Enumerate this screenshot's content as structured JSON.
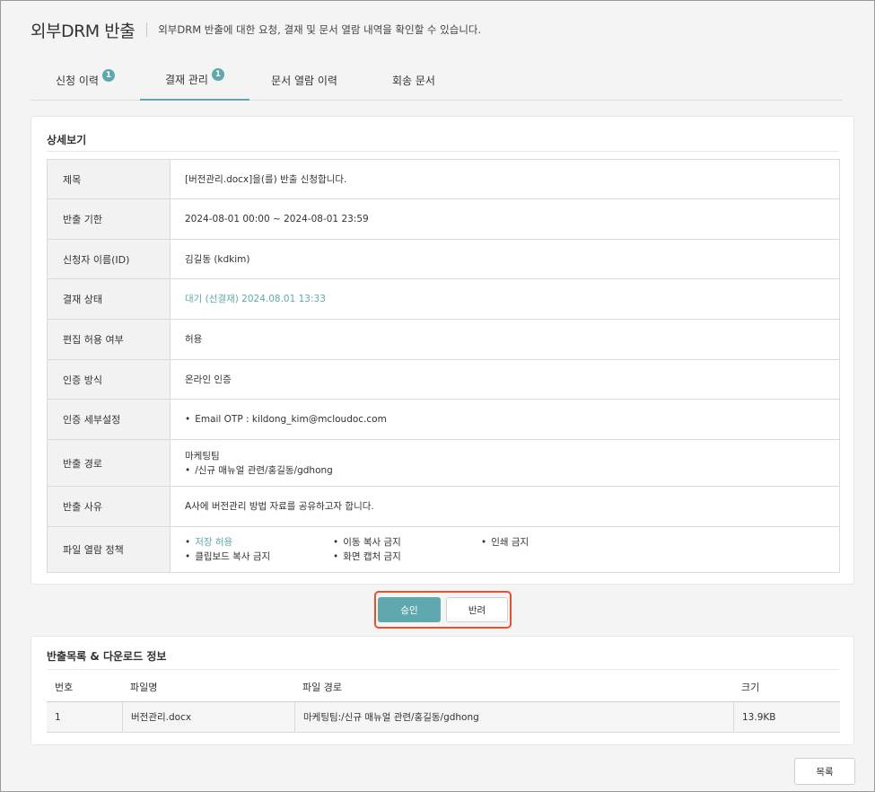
{
  "header": {
    "title": "외부DRM 반출",
    "description": "외부DRM 반출에 대한 요청, 결재 및 문서 열람 내역을 확인할 수 있습니다."
  },
  "tabs": [
    {
      "label": "신청 이력",
      "badge": "1"
    },
    {
      "label": "결재 관리",
      "badge": "1",
      "active": true
    },
    {
      "label": "문서 열람 이력"
    },
    {
      "label": "회송 문서"
    }
  ],
  "detail": {
    "title": "상세보기",
    "rows": {
      "subject": {
        "label": "제목",
        "value": "[버전관리.docx]을(를) 반출 신청합니다."
      },
      "period": {
        "label": "반출 기한",
        "value": "2024-08-01 00:00 ~ 2024-08-01 23:59"
      },
      "applicant": {
        "label": "신청자 이름(ID)",
        "value": "김길동 (kdkim)"
      },
      "status": {
        "label": "결재 상태",
        "value": "대기 (선결재) 2024.08.01 13:33"
      },
      "edit": {
        "label": "편집 허용 여부",
        "value": "허용"
      },
      "auth": {
        "label": "인증 방식",
        "value": "온라인 인증"
      },
      "auth_detail": {
        "label": "인증 세부설정",
        "value": "Email OTP : kildong_kim@mcloudoc.com"
      },
      "path": {
        "label": "반출 경로",
        "line1": "마케팅팀",
        "line2": "/신규 매뉴얼 관련/홍길동/gdhong"
      },
      "reason": {
        "label": "반출 사유",
        "value": "A사에 버전관리 방법 자료를 공유하고자 합니다."
      },
      "policy": {
        "label": "파일 열람 정책",
        "items": [
          "저장 허용",
          "이동 복사 금지",
          "인쇄 금지",
          "클립보드 복사 금지",
          "화면 캡처 금지"
        ]
      }
    }
  },
  "actions": {
    "approve": "승인",
    "reject": "반려"
  },
  "files": {
    "title": "반출목록 & 다운로드 정보",
    "columns": [
      "번호",
      "파일명",
      "파일 경로",
      "크기"
    ],
    "rows": [
      {
        "no": "1",
        "name": "버전관리.docx",
        "path": "마케팅팀:/신규 매뉴얼 관련/홍길동/gdhong",
        "size": "13.9KB"
      }
    ]
  },
  "footer": {
    "list_label": "목록"
  },
  "colors": {
    "accent": "#5ea8ae",
    "highlight_border": "#e8522b"
  }
}
